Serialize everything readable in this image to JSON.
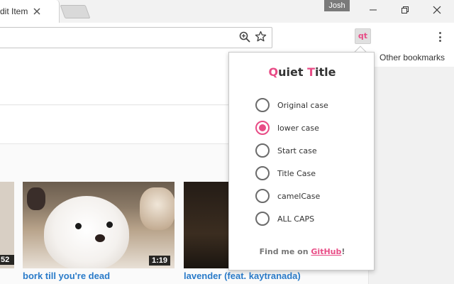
{
  "browser": {
    "tab_title": "dit Item",
    "profile_name": "Josh",
    "bookmarks_other": "Other bookmarks",
    "extension_badge": "qt"
  },
  "page": {
    "videos": [
      {
        "duration": "52",
        "title": ""
      },
      {
        "duration": "1:19",
        "title": "bork till you're dead"
      },
      {
        "duration": "",
        "title": "lavender (feat. kaytranada)"
      }
    ]
  },
  "popup": {
    "title_q": "Q",
    "title_uiet": "uiet ",
    "title_t": "T",
    "title_itle": "itle",
    "options": [
      {
        "label": "Original case",
        "checked": false
      },
      {
        "label": "lower case",
        "checked": true
      },
      {
        "label": "Start case",
        "checked": false
      },
      {
        "label": "Title Case",
        "checked": false
      },
      {
        "label": "camelCase",
        "checked": false
      },
      {
        "label": "ALL CAPS",
        "checked": false
      }
    ],
    "footer_prefix": "Find me on ",
    "footer_link": "GitHub",
    "footer_suffix": "!"
  },
  "colors": {
    "accent": "#e84c86",
    "link": "#2a7bc9"
  },
  "icons": [
    "close-icon",
    "minimize-icon",
    "restore-icon",
    "window-close-icon",
    "zoom-icon",
    "star-icon",
    "menu-dots-icon"
  ]
}
